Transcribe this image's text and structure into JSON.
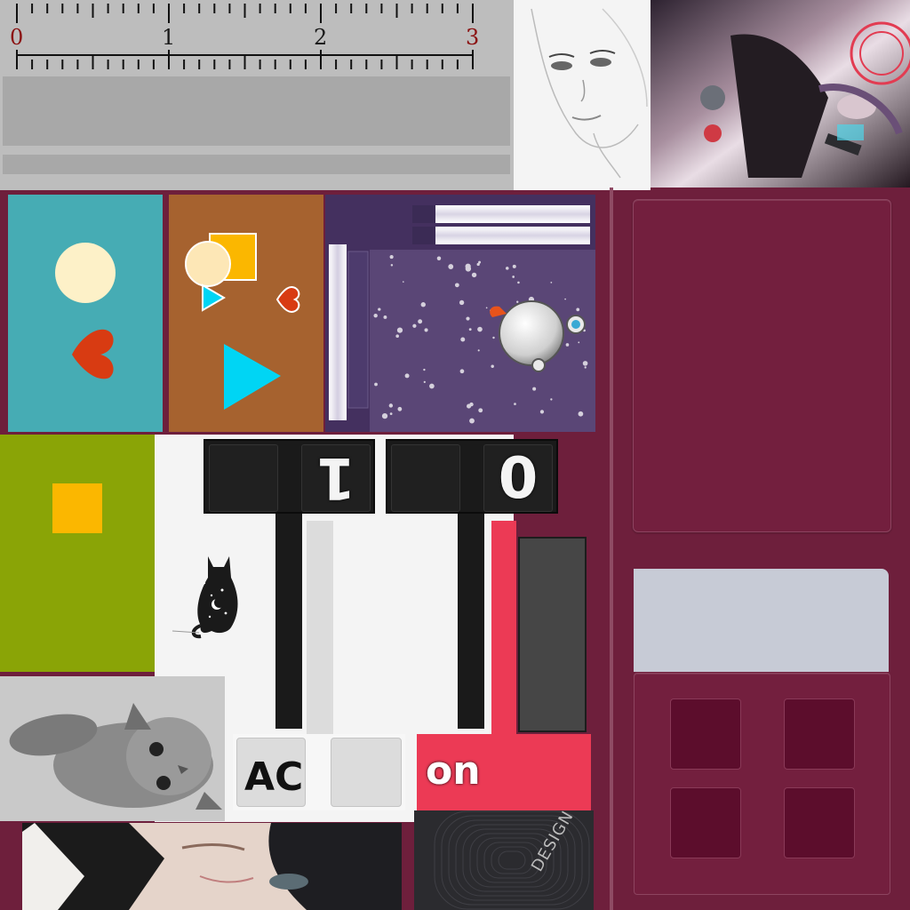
{
  "ruler": {
    "labels": [
      "0",
      "1",
      "2",
      "3"
    ]
  },
  "display": {
    "digit_left": "1",
    "digit_right": "0"
  },
  "buttons": {
    "ac": "AC",
    "on": "on"
  },
  "design_card": {
    "text": "DESIGN"
  },
  "colors": {
    "background": "#6e1f3c",
    "teal": "#46acb4",
    "brown": "#a6622f",
    "green": "#8aa406",
    "accent_red": "#ec3a55",
    "yellow": "#fbb700",
    "cyan": "#00d5f4",
    "heart_red": "#d83b12",
    "cream": "#fdf1c8"
  }
}
